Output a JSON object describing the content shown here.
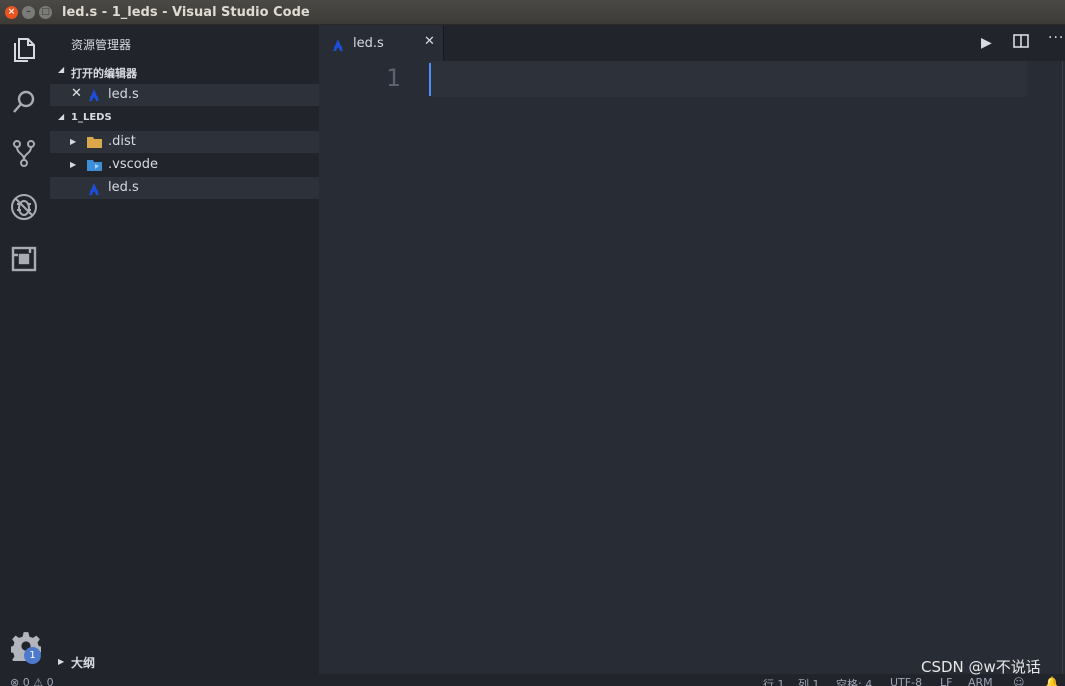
{
  "window": {
    "title": "led.s - 1_leds - Visual Studio Code",
    "close_glyph": "×",
    "min_glyph": "–",
    "max_glyph": "□"
  },
  "sidebar": {
    "title": "资源管理器",
    "open_editors": {
      "label": "打开的编辑器",
      "items": [
        {
          "label": "led.s",
          "icon": "asm-file-icon"
        }
      ]
    },
    "project": {
      "label": "1_LEDS",
      "items": [
        {
          "label": ".dist",
          "icon": "folder-icon"
        },
        {
          "label": ".vscode",
          "icon": "vscode-folder-icon"
        },
        {
          "label": "led.s",
          "icon": "asm-file-icon"
        }
      ]
    },
    "outline": {
      "label": "大纲"
    }
  },
  "activity": {
    "settings_badge": "1"
  },
  "editor": {
    "tab_label": "led.s",
    "line_numbers": [
      "1"
    ]
  },
  "statusbar": {
    "problems": "⊗ 0 ⚠ 0",
    "line": "行 1",
    "col": "列 1",
    "spaces": "空格: 4",
    "encoding": "UTF-8",
    "eol": "LF",
    "language": "ARM"
  },
  "watermark": "CSDN @w不说话",
  "colors": {
    "accent": "#528bff",
    "badge": "#4d78cc",
    "folder": "#d9a84a",
    "vscode_folder": "#3c8fd6",
    "asm_icon": "#1d4ed8"
  }
}
